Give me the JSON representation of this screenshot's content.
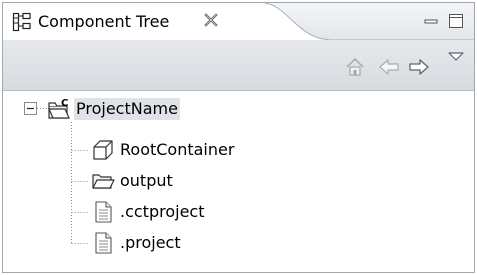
{
  "view": {
    "title": "Component Tree",
    "tab_icon": "component-tree-icon",
    "close_icon": "close-icon",
    "minimize_icon": "minimize-icon",
    "maximize_icon": "maximize-icon"
  },
  "toolbar": {
    "items": [
      {
        "name": "home-icon"
      },
      {
        "name": "back-arrow-icon"
      },
      {
        "name": "forward-arrow-icon"
      },
      {
        "name": "view-menu-icon"
      }
    ]
  },
  "tree": {
    "root": {
      "label": "ProjectName",
      "icon": "project-folder-icon",
      "expanded": true,
      "selected": true
    },
    "children": [
      {
        "label": "RootContainer",
        "icon": "container-icon"
      },
      {
        "label": "output",
        "icon": "open-folder-icon"
      },
      {
        "label": ".cctproject",
        "icon": "file-icon"
      },
      {
        "label": ".project",
        "icon": "file-icon"
      }
    ]
  },
  "colors": {
    "selection": "#dfe3e8",
    "border": "#9ea7b2"
  }
}
